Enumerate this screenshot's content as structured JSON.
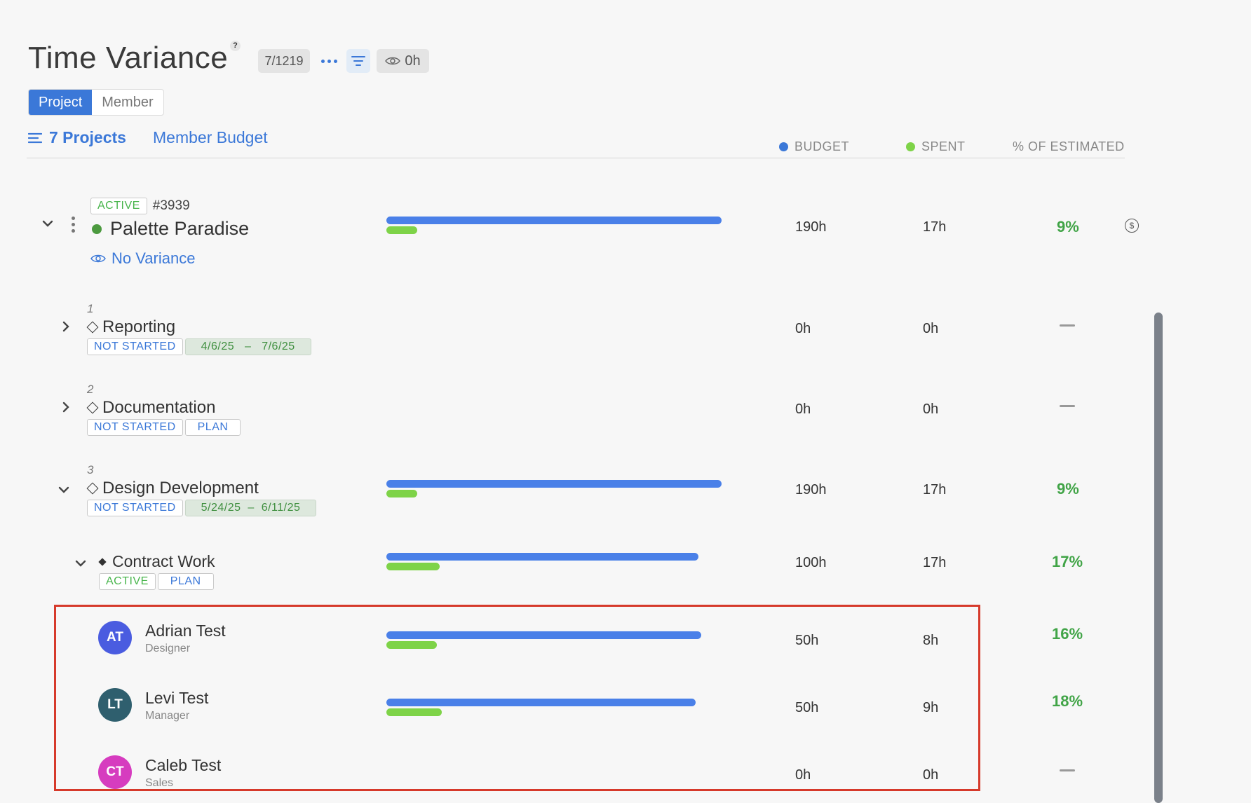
{
  "header": {
    "title": "Time Variance",
    "help_label": "?",
    "count": "7/1219",
    "eye_value": "0h"
  },
  "view_toggle": {
    "project": "Project",
    "member": "Member"
  },
  "subheader": {
    "projects_link": "7 Projects",
    "member_budget": "Member Budget"
  },
  "columns": {
    "budget": "BUDGET",
    "spent": "SPENT",
    "percent": "% OF ESTIMATED",
    "budget_color": "#3b78d8",
    "spent_color": "#7ed348"
  },
  "project": {
    "status": "ACTIVE",
    "number": "#3939",
    "name": "Palette Paradise",
    "variance": "No Variance",
    "budget": "190h",
    "spent": "17h",
    "percent": "9%",
    "bar_budget_frac": 1.0,
    "bar_spent_frac": 0.09
  },
  "phases": [
    {
      "index": "1",
      "name": "Reporting",
      "status": "NOT STARTED",
      "date_start": "4/6/25",
      "date_sep": "–",
      "date_end": "7/6/25",
      "budget": "0h",
      "spent": "0h"
    },
    {
      "index": "2",
      "name": "Documentation",
      "status": "NOT STARTED",
      "tag2": "PLAN",
      "budget": "0h",
      "spent": "0h"
    },
    {
      "index": "3",
      "name": "Design Development",
      "status": "NOT STARTED",
      "date_start": "5/24/25",
      "date_sep": "–",
      "date_end": "6/11/25",
      "budget": "190h",
      "spent": "17h",
      "percent": "9%",
      "bar_budget_frac": 1.0,
      "bar_spent_frac": 0.09
    }
  ],
  "work_category": {
    "name": "Contract Work",
    "status": "ACTIVE",
    "tag2": "PLAN",
    "budget": "100h",
    "spent": "17h",
    "percent": "17%",
    "bar_budget_frac": 0.93,
    "bar_spent_frac": 0.16
  },
  "members": [
    {
      "initials": "AT",
      "name": "Adrian Test",
      "role": "Designer",
      "budget": "50h",
      "spent": "8h",
      "percent": "16%",
      "avatar_color": "#4a5ce0",
      "bar_budget_frac": 0.94,
      "bar_spent_frac": 0.15
    },
    {
      "initials": "LT",
      "name": "Levi Test",
      "role": "Manager",
      "budget": "50h",
      "spent": "9h",
      "percent": "18%",
      "avatar_color": "#2f5f6e",
      "bar_budget_frac": 0.92,
      "bar_spent_frac": 0.17
    },
    {
      "initials": "CT",
      "name": "Caleb Test",
      "role": "Sales",
      "budget": "0h",
      "spent": "0h",
      "avatar_color": "#d63cbf"
    }
  ]
}
